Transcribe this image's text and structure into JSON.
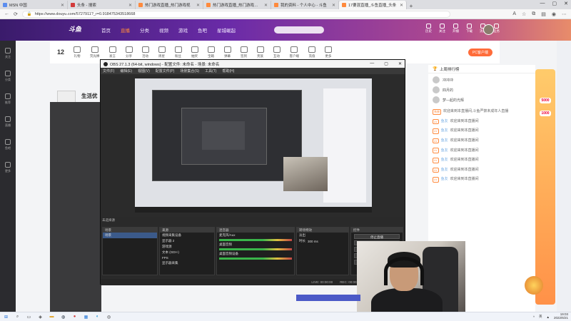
{
  "browser": {
    "tabs": [
      {
        "label": "MSN 中国",
        "active": false
      },
      {
        "label": "头条 - 搜索",
        "active": false
      },
      {
        "label": "热门游戏直播_热门游戏视",
        "active": false
      },
      {
        "label": "热门游戏直播_热门游戏视_热",
        "active": false
      },
      {
        "label": "我的资料 - 个人中心 - 斗鱼",
        "active": false
      },
      {
        "label": "17要混直播_斗鱼直播_头条",
        "active": true
      }
    ],
    "new_tab": "+",
    "url": "https://www.douyu.com/5727911?_r=0.918475343518668",
    "window_controls": [
      "—",
      "▢",
      "✕"
    ]
  },
  "site": {
    "logo": "斗鱼",
    "nav": [
      "首页",
      "直播",
      "分类",
      "视频",
      "游戏",
      "鱼吧",
      "星城崛起"
    ],
    "active_nav": "直播",
    "user_nav": [
      "历史",
      "关注",
      "开播",
      "下载",
      "消息",
      "任务"
    ],
    "streamer": {
      "level": "12",
      "name": "生活优"
    },
    "pc_button": "PC客户端",
    "gift_labels": [
      "礼物",
      "荧光棒",
      "发言",
      "分享",
      "活动",
      "周星",
      "粉丝",
      "抽奖",
      "宝箱",
      "弹幕",
      "签到",
      "贵族",
      "互动",
      "客户端",
      "充值",
      "更多"
    ],
    "left_rail": [
      "关注",
      "分类",
      "推荐",
      "直播",
      "鱼吧",
      "更多"
    ]
  },
  "obs": {
    "title": "OBS 27.1.3 (64-bit, windows) - 配置文件: 未命名 - 场景: 未命名",
    "menu": [
      "文件(F)",
      "编辑(E)",
      "视图(V)",
      "配置文件(P)",
      "场景集合(S)",
      "工具(T)",
      "帮助(H)"
    ],
    "panels": {
      "scenes": {
        "title": "场景",
        "items": [
          "场景"
        ]
      },
      "sources": {
        "title": "来源",
        "items": [
          "视频采集设备",
          "显示器 2",
          "游戏源",
          "文本 (GDI+)",
          "FPS",
          "显示器采集"
        ]
      },
      "mixer": {
        "title": "混音器",
        "items": [
          "麦克风/Aux",
          "桌面音频",
          "桌面音频设备"
        ]
      },
      "transitions": {
        "title": "转场特效",
        "value": "淡出",
        "duration_label": "时长",
        "duration": "300 ms"
      },
      "controls": {
        "title": "控件",
        "buttons": [
          "停止直播",
          "开始录制",
          "工作室模式",
          "设置",
          "退出"
        ]
      }
    },
    "scene_tab": "未选择源",
    "status": [
      "LIVE: 00:00:00",
      "REC: 00:00:00",
      "CPU: 2.4%, 30.00 fps"
    ]
  },
  "chat": {
    "header": "上周排行榜",
    "ranks": [
      "冲冲冲",
      "四月的",
      "梦—起的光辉"
    ],
    "messages": [
      {
        "tag": "系统",
        "name": "",
        "text": "欢迎来到本直播间,斗鱼严禁未成年人直播"
      },
      {
        "tag": "LV",
        "name": "鱼友",
        "text": "欢迎来到本直播间"
      },
      {
        "tag": "LV",
        "name": "鱼友",
        "text": "欢迎来到本直播间"
      },
      {
        "tag": "LV",
        "name": "鱼友",
        "text": "欢迎来到本直播间"
      },
      {
        "tag": "LV",
        "name": "鱼友",
        "text": "欢迎来到本直播间"
      },
      {
        "tag": "LV",
        "name": "鱼友",
        "text": "欢迎来到本直播间"
      },
      {
        "tag": "LV",
        "name": "鱼友",
        "text": "欢迎来到本直播间"
      },
      {
        "tag": "LV",
        "name": "鱼友",
        "text": "欢迎来到本直播间"
      }
    ]
  },
  "promo": {
    "values": [
      "5000",
      "1000"
    ]
  },
  "taskbar": {
    "time": "19:03",
    "date": "2022/6/21",
    "tray": [
      "^",
      "英",
      "▲"
    ]
  },
  "colors": {
    "brand_gradient_start": "#3a1b6b",
    "brand_accent": "#ff8a3d",
    "obs_bg": "#2b2b2b"
  }
}
